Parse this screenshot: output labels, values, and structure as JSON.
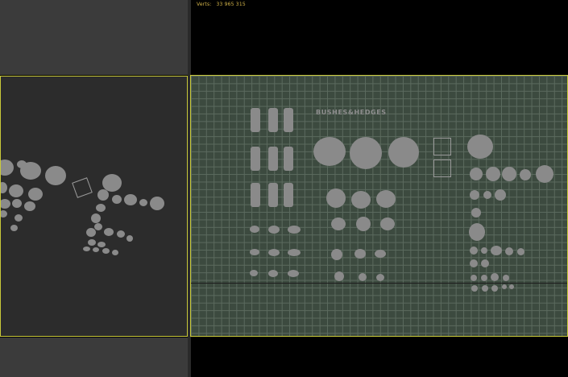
{
  "viewports": {
    "top_left": {
      "label": ""
    },
    "top_right": {
      "label": ""
    },
    "middle_left": {
      "label": ""
    },
    "middle_right": {
      "label": ""
    },
    "bottom_left": {
      "label": ""
    },
    "bottom_right": {
      "label": ""
    }
  },
  "stats": {
    "verts_label": "Verts:",
    "verts_value": "33 965 315"
  },
  "scene": {
    "title": "BUSHES&HEDGES"
  },
  "colors": {
    "viewport_border": "#c9c93a",
    "grid_bg": "#3c4a3f",
    "stats_text": "#d6b64a",
    "object_gray": "#8a8a8a"
  }
}
